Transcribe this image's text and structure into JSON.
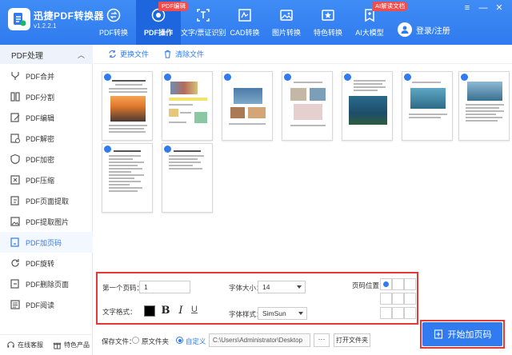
{
  "app": {
    "name": "迅捷PDF转换器",
    "version": "v1.2.2.1"
  },
  "nav": [
    {
      "label": "PDF转换",
      "icon": "pdf-convert-icon"
    },
    {
      "label": "PDF操作",
      "icon": "pdf-operation-icon",
      "active": true,
      "badge": "PDF编辑"
    },
    {
      "label": "文字/票证识别",
      "icon": "ocr-icon"
    },
    {
      "label": "CAD转换",
      "icon": "cad-icon"
    },
    {
      "label": "图片转换",
      "icon": "image-icon"
    },
    {
      "label": "特色转换",
      "icon": "special-icon"
    },
    {
      "label": "AI大模型",
      "icon": "ai-icon",
      "badge": "AI解读文档"
    }
  ],
  "user": {
    "login_label": "登录/注册"
  },
  "window": {
    "menu": "≡",
    "minimize": "—",
    "close": "✕"
  },
  "sidebar": {
    "header": "PDF处理",
    "items": [
      {
        "label": "PDF合并",
        "icon": "merge-icon"
      },
      {
        "label": "PDF分割",
        "icon": "split-icon"
      },
      {
        "label": "PDF编辑",
        "icon": "edit-icon"
      },
      {
        "label": "PDF解密",
        "icon": "unlock-icon"
      },
      {
        "label": "PDF加密",
        "icon": "lock-icon"
      },
      {
        "label": "PDF压缩",
        "icon": "compress-icon"
      },
      {
        "label": "PDF页面提取",
        "icon": "page-extract-icon"
      },
      {
        "label": "PDF提取图片",
        "icon": "image-extract-icon"
      },
      {
        "label": "PDF加页码",
        "icon": "page-number-icon",
        "active": true
      },
      {
        "label": "PDF旋转",
        "icon": "rotate-icon"
      },
      {
        "label": "PDF删除页面",
        "icon": "delete-page-icon"
      },
      {
        "label": "PDF阅读",
        "icon": "read-icon"
      }
    ],
    "bottom": {
      "service": "在线客服",
      "products": "特色产品"
    }
  },
  "toolbar": {
    "replace": "更换文件",
    "clear": "清除文件"
  },
  "settings": {
    "first_page_label": "第一个页码：",
    "first_page_value": "1",
    "font_size_label": "字体大小：",
    "font_size_value": "14",
    "text_format_label": "文字格式：",
    "text_color": "#000000",
    "bold": "B",
    "italic": "I",
    "underline": "U",
    "font_style_label": "字体样式：",
    "font_style_value": "SimSun",
    "position_label": "页码位置：",
    "position_selected": "top-left"
  },
  "save": {
    "label": "保存文件：",
    "source_folder": "原文件夹",
    "custom": "自定义",
    "path": "C:\\Users\\Administrator\\Desktop",
    "browse": "···",
    "open_folder": "打开文件夹",
    "selected": "custom"
  },
  "start_button": "开始加页码",
  "colors": {
    "brand": "#2f7bef",
    "highlight": "#e53935"
  }
}
